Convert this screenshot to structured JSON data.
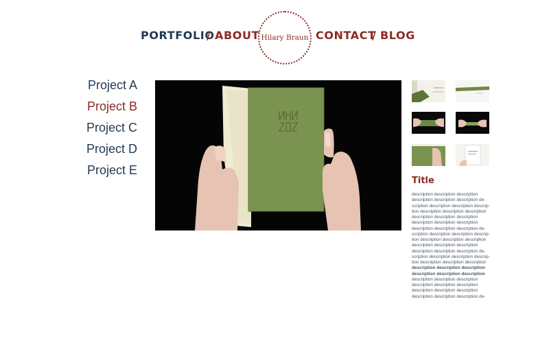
{
  "colors": {
    "navy": "#233a53",
    "maroon": "#8b2b22",
    "text_gray": "#4a5560",
    "book_green": "#7b9350",
    "page_cream": "#efecd4",
    "skin": "#e6c3b2"
  },
  "nav": {
    "portfolio": "PORTFOLIO",
    "about": "ABOUT",
    "contact": "CONTACT",
    "blog": "BLOG",
    "separator": "/"
  },
  "logo": {
    "name": "Hilary Braun"
  },
  "projects": [
    {
      "label": "Project  A",
      "active": false
    },
    {
      "label": "Project B",
      "active": true
    },
    {
      "label": "Project C",
      "active": false
    },
    {
      "label": "Project D",
      "active": false
    },
    {
      "label": "Project E",
      "active": false
    }
  ],
  "sidebar": {
    "title": "Title",
    "description_lines": [
      "description description description",
      "description description description de-",
      "scription description description descrip-",
      "tion description description description",
      "description description description",
      "description description description",
      "description description description de-",
      "scription description description descrip-",
      "tion description description description",
      "description description description",
      "description description description de-",
      "scription description description descrip-",
      "tion description description description",
      "description description description",
      "description description description",
      "description description description",
      "description description description",
      "description description description",
      "description description description de-"
    ]
  }
}
